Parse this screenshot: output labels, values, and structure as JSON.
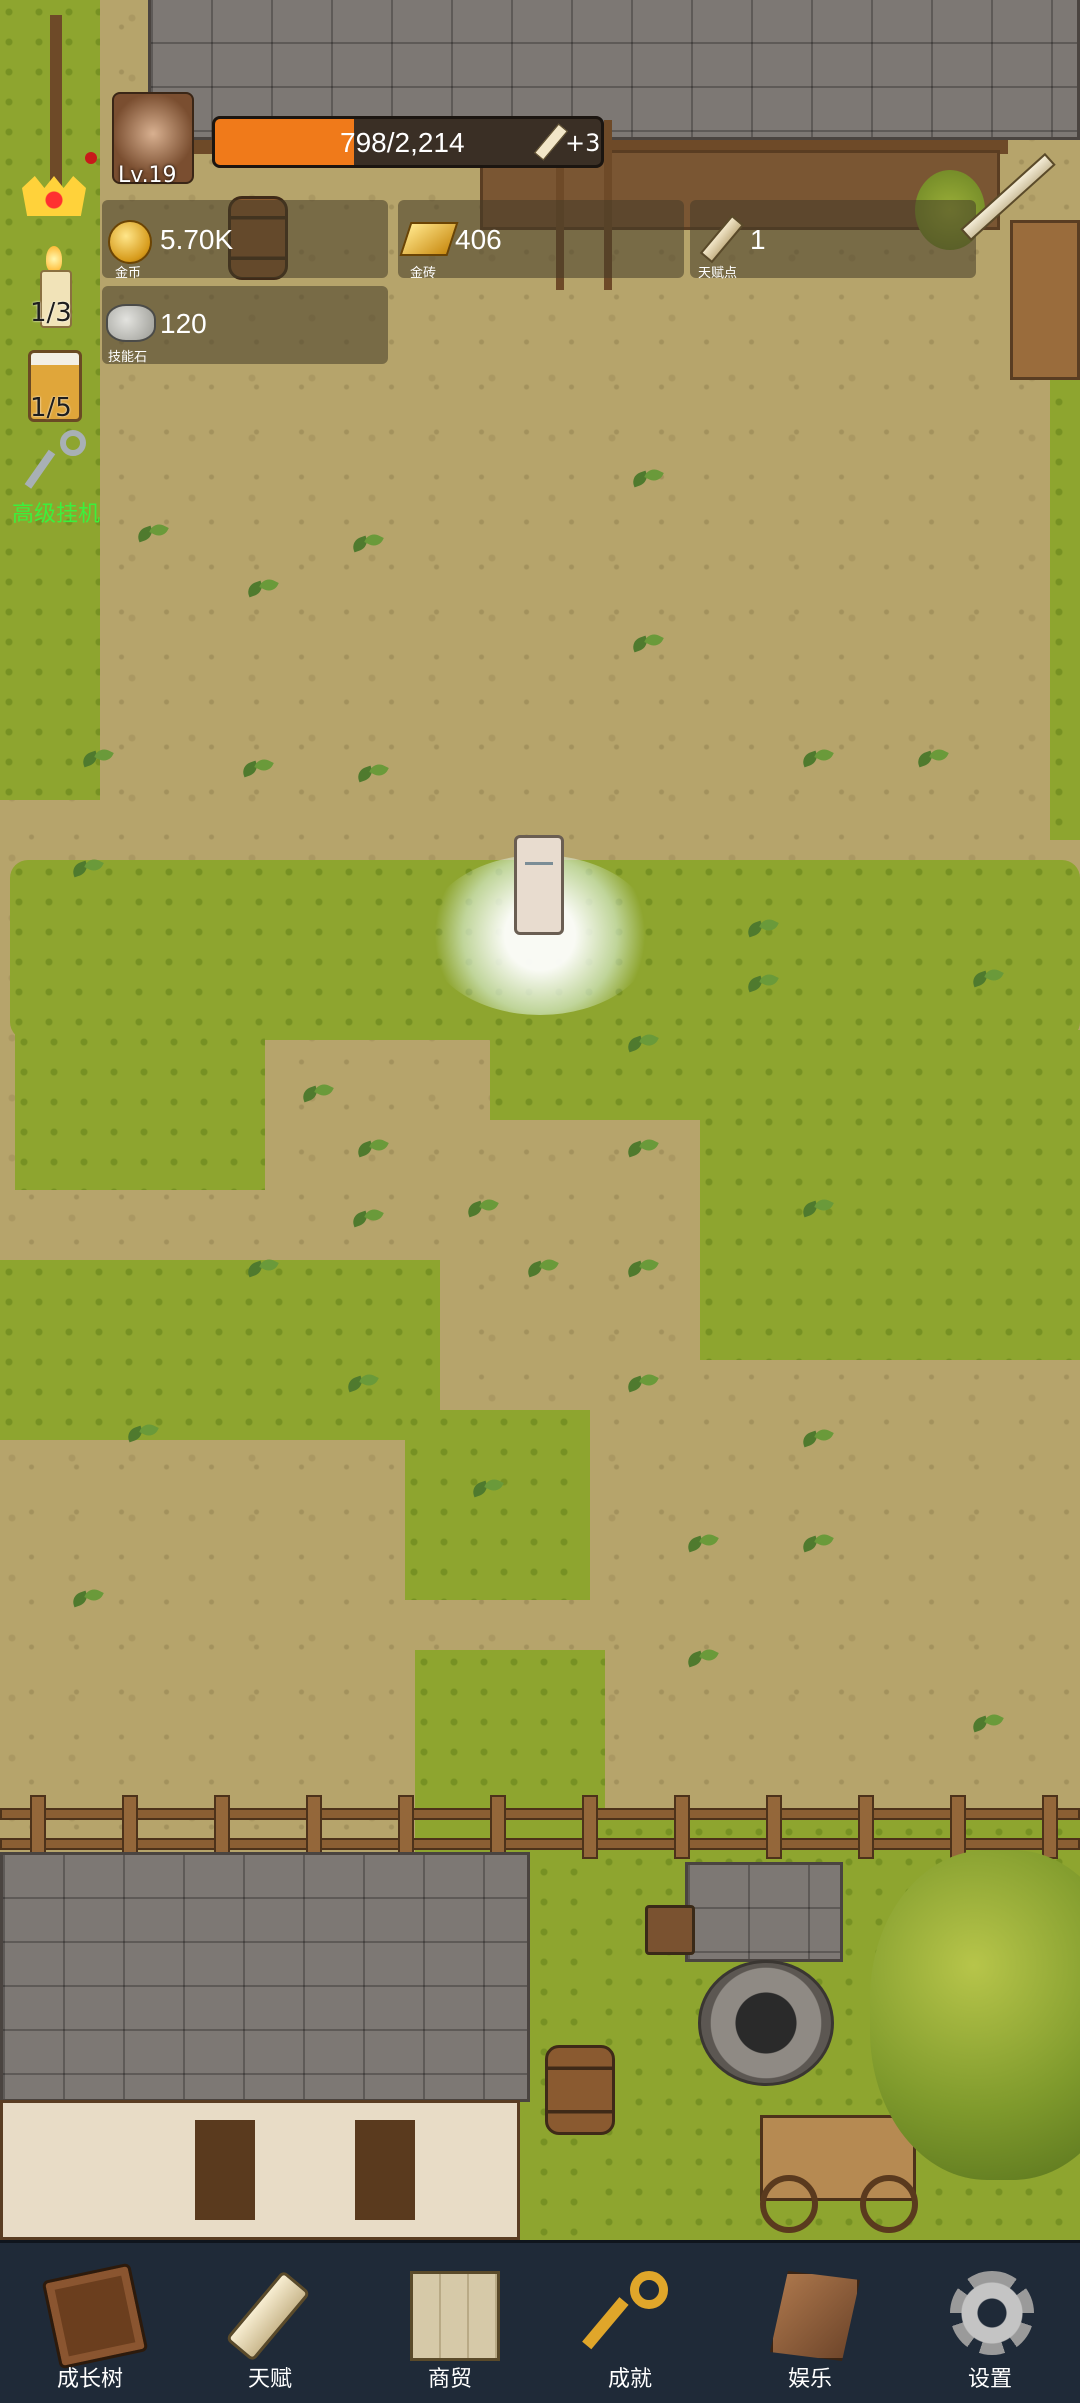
{
  "player": {
    "level": "Lv.19",
    "exp_text": "798/2,214",
    "exp_fraction": 0.36,
    "bonus_text": "+3"
  },
  "resources": {
    "gold": {
      "value": "5.70K",
      "label": "金币",
      "icon": "gold-coin-icon"
    },
    "gold_brick": {
      "value": "406",
      "label": "金砖",
      "icon": "gold-bar-icon"
    },
    "talent_points": {
      "value": "1",
      "label": "天赋点",
      "icon": "scroll-icon"
    },
    "skill_stone": {
      "value": "120",
      "label": "技能石",
      "icon": "stone-icon"
    }
  },
  "left_panel": {
    "candle_count": "1/3",
    "beer_count": "1/5",
    "auto_idle_label": "高级挂机"
  },
  "nav": [
    {
      "label": "成长树",
      "icon": "book-icon"
    },
    {
      "label": "天赋",
      "icon": "scroll-icon"
    },
    {
      "label": "商贸",
      "icon": "map-icon"
    },
    {
      "label": "成就",
      "icon": "key-icon"
    },
    {
      "label": "娱乐",
      "icon": "flag-icon"
    },
    {
      "label": "设置",
      "icon": "gear-icon"
    }
  ],
  "colors": {
    "exp_bar": "#f07a1a",
    "nav_bg": "#1f2a38",
    "auto_label": "#3cf03c",
    "grass": "#8ea52f",
    "dirt": "#b6a46b"
  }
}
